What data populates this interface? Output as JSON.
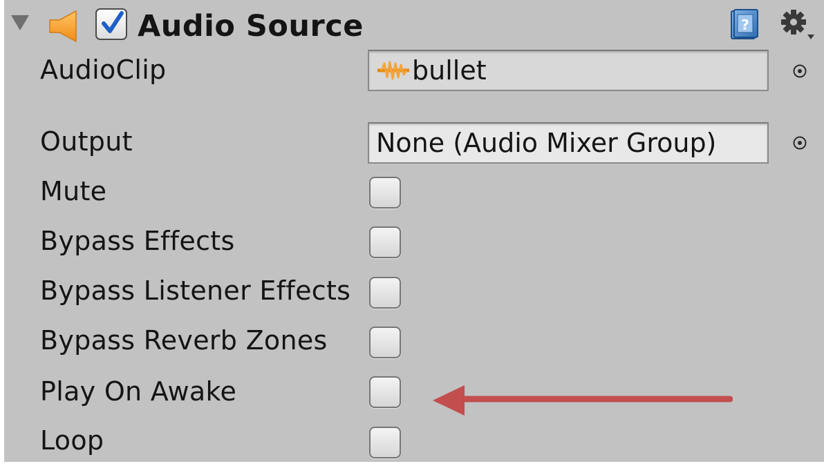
{
  "header": {
    "title": "Audio Source",
    "enabled": true,
    "icons": [
      "foldout-triangle-icon",
      "speaker-icon",
      "checkmark-icon",
      "help-book-icon",
      "gear-icon"
    ]
  },
  "properties": {
    "audioclip": {
      "label": "AudioClip",
      "value": "bullet",
      "icon": "audio-clip-icon"
    },
    "output": {
      "label": "Output",
      "value": "None (Audio Mixer Group)"
    },
    "mute": {
      "label": "Mute",
      "checked": false
    },
    "bypass_effects": {
      "label": "Bypass Effects",
      "checked": false
    },
    "bypass_listener_effects": {
      "label": "Bypass Listener Effects",
      "checked": false
    },
    "bypass_reverb_zones": {
      "label": "Bypass Reverb Zones",
      "checked": false
    },
    "play_on_awake": {
      "label": "Play On Awake",
      "checked": false
    },
    "loop": {
      "label": "Loop",
      "checked": false
    }
  },
  "annotation": {
    "type": "arrow",
    "color": "#c24e4e",
    "points_to": "play_on_awake"
  },
  "colors": {
    "panel_bg": "#c2c2c2",
    "speaker_orange": "#f7a531",
    "check_blue": "#1f5fc8"
  }
}
